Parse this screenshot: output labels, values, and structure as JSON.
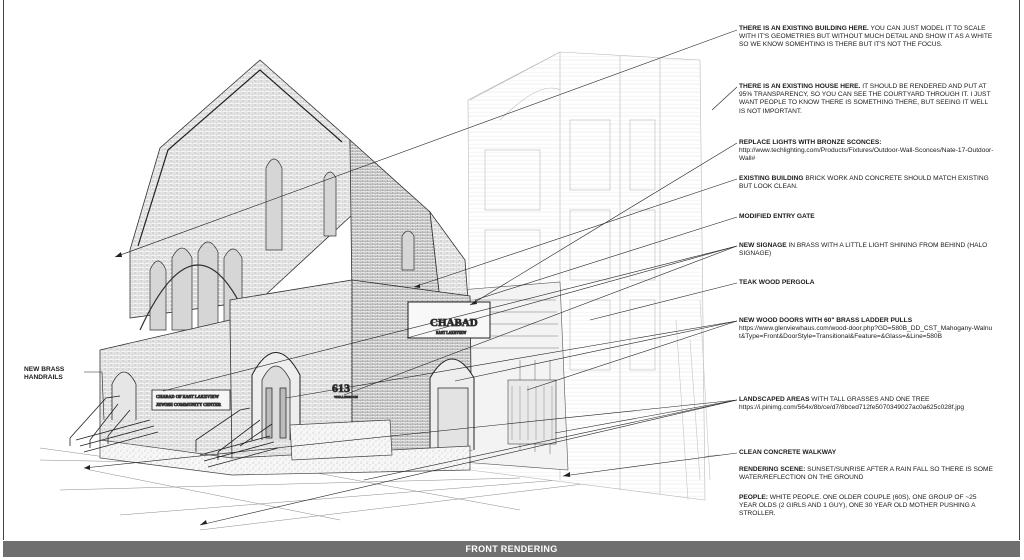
{
  "sheet": {
    "footer_title": "FRONT RENDERING"
  },
  "labels": {
    "handrails": "NEW BRASS HANDRAILS",
    "sign_main": "CHABAD",
    "sign_main_sub": "EAST LAKEVIEW",
    "sign_entry_1": "CHABAD OF EAST LAKEVIEW",
    "sign_entry_2": "JEWISH COMMUNITY CENTER",
    "address": "613",
    "address_sub": "WELLINGTON"
  },
  "notes": [
    {
      "head": "THERE IS AN EXISTING BUILDING HERE.",
      "body": " YOU CAN JUST MODEL IT TO SCALE WITH IT'S GEOMETRIES BUT WITHOUT MUCH DETAIL AND SHOW IT AS A WHITE SO WE KNOW SOMEHTING IS THERE BUT IT'S NOT THE FOCUS.",
      "url": ""
    },
    {
      "head": "THERE IS AN EXISTING HOUSE HERE.",
      "body": " IT SHOULD BE RENDERED AND PUT AT 95% TRANSPARENCY, SO YOU CAN SEE THE COURTYARD THROUGH IT. I JUST WANT PEOPLE TO KNOW THERE IS SOMETHING THERE, BUT SEEING IT WELL IS NOT IMPORTANT.",
      "url": ""
    },
    {
      "head": "REPLACE LIGHTS WITH BRONZE SCONCES:",
      "body": "",
      "url": "http://www.techlighting.com/Products/Fixtures/Outdoor-Wall-Sconces/Nate-17-Outdoor-Wall#"
    },
    {
      "head": "EXISTING BUILDING",
      "body": " BRICK WORK AND CONCRETE SHOULD MATCH EXISTING BUT LOOK CLEAN.",
      "url": ""
    },
    {
      "head": "MODIFIED ENTRY GATE",
      "body": "",
      "url": ""
    },
    {
      "head": "NEW SIGNAGE",
      "body": " IN BRASS WITH A LITTLE LIGHT SHINING FROM BEHIND (HALO SIGNAGE)",
      "url": ""
    },
    {
      "head": "TEAK WOOD PERGOLA",
      "body": "",
      "url": ""
    },
    {
      "head": "NEW WOOD DOORS WITH 60\" BRASS LADDER PULLS",
      "body": "",
      "url": "https://www.glenviewhaus.com/wood-door.php?GD=580B_DD_CST_Mahogany-Walnut&Type=Front&DoorStyle=Transitional&Feature=&Glass=&Line=580B"
    },
    {
      "head": "LANDSCAPED AREAS",
      "body": " WITH TALL GRASSES AND ONE TREE",
      "url": "https://i.pinimg.com/564x/8b/ce/d7/8bced712fe5070349027ac0a625c028f.jpg"
    },
    {
      "head": "CLEAN CONCRETE WALKWAY",
      "body": "",
      "url": ""
    },
    {
      "head": "RENDERING SCENE:",
      "body": " SUNSET/SUNRISE AFTER A RAIN FALL SO THERE IS SOME WATER/REFLECTION ON THE GROUND",
      "url": ""
    },
    {
      "head": "PEOPLE:",
      "body": " WHITE PEOPLE. ONE OLDER COUPLE (60s), ONE GROUP OF ~25 YEAR OLDS (2 GIRLS AND 1 GUY), ONE 30 YEAR OLD MOTHER PUSHING A STROLLER.",
      "url": ""
    }
  ]
}
